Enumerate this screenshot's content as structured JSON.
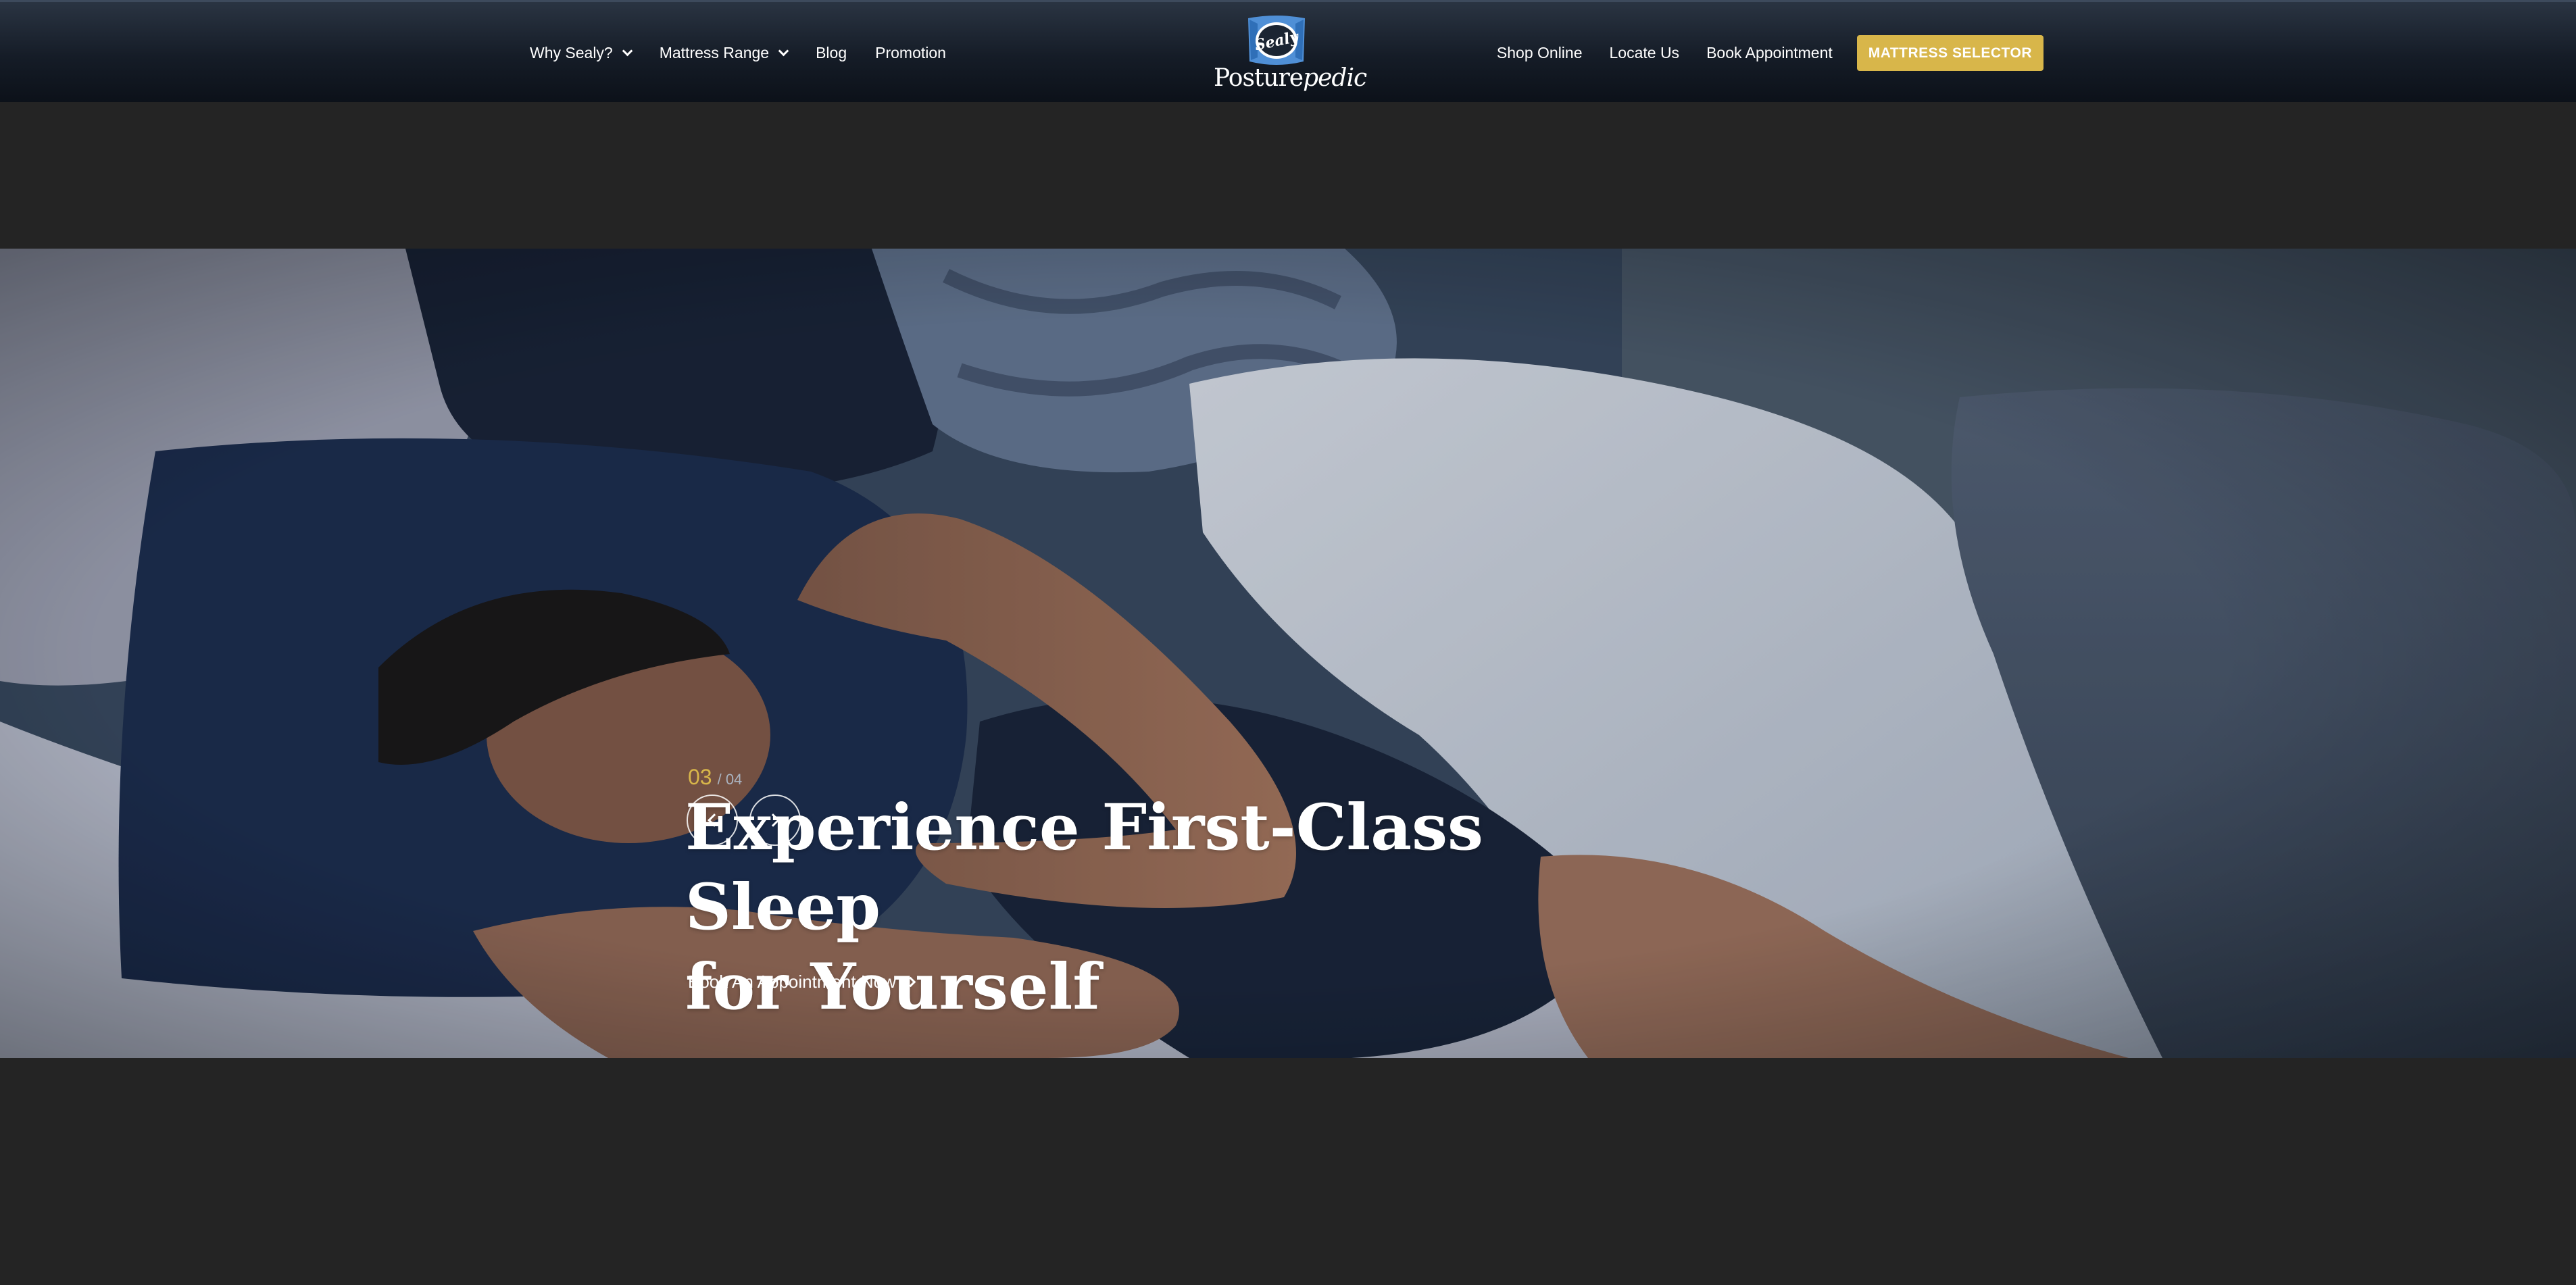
{
  "header": {
    "nav_left": [
      {
        "label": "Why Sealy?",
        "has_dropdown": true
      },
      {
        "label": "Mattress Range",
        "has_dropdown": true
      },
      {
        "label": "Blog",
        "has_dropdown": false
      },
      {
        "label": "Promotion",
        "has_dropdown": false
      }
    ],
    "logo": {
      "badge_text": "Sealy",
      "wordmark_bold": "Posture",
      "wordmark_italic": "pedic"
    },
    "nav_right": [
      {
        "label": "Shop Online"
      },
      {
        "label": "Locate Us"
      },
      {
        "label": "Book Appointment"
      }
    ],
    "cta_button": "MATTRESS SELECTOR"
  },
  "hero": {
    "slide_current": "03",
    "slide_total": "/ 04",
    "headline_line1": "Experience First-Class Sleep",
    "headline_line2": "for Yourself",
    "cta_link": "Book An Appointment Now",
    "prev_icon": "chevron-left-icon",
    "next_icon": "chevron-right-icon"
  },
  "colors": {
    "accent_gold": "#d8b64a",
    "header_bg": "#151c27",
    "page_bg": "#242424"
  }
}
